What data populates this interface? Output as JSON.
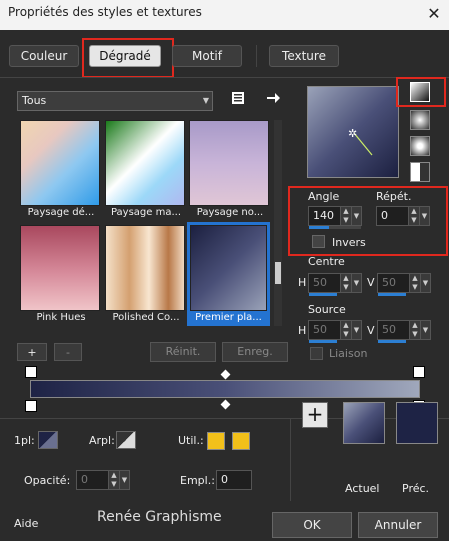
{
  "window": {
    "title": "Propriétés des styles et textures",
    "close": "✕"
  },
  "tabs": {
    "couleur": "Couleur",
    "degrade": "Dégradé",
    "motif": "Motif",
    "texture": "Texture"
  },
  "category": {
    "selected": "Tous"
  },
  "gradients": [
    {
      "label": "Paysage dé..."
    },
    {
      "label": "Paysage ma..."
    },
    {
      "label": "Paysage no..."
    },
    {
      "label": "Pink Hues"
    },
    {
      "label": "Polished Co..."
    },
    {
      "label": "Premier pla..."
    }
  ],
  "list_buttons": {
    "add": "+",
    "remove": "-",
    "reset": "Réinit.",
    "save": "Enreg."
  },
  "angle": {
    "label": "Angle",
    "value": "140",
    "level": 0.39
  },
  "repeat": {
    "label": "Répét.",
    "value": "0"
  },
  "invert": {
    "label": "Invers"
  },
  "centre": {
    "label": "Centre",
    "h_label": "H",
    "h_value": "50",
    "v_label": "V",
    "v_value": "50"
  },
  "source": {
    "label": "Source",
    "h_label": "H",
    "h_value": "50",
    "v_label": "V",
    "v_value": "50"
  },
  "link": {
    "label": "Liaison"
  },
  "bottom": {
    "one_px": "1pl:",
    "arpl": "Arpl:",
    "util": "Util.:",
    "opacity_label": "Opacité:",
    "opacity_value": "0",
    "empl_label": "Empl.:",
    "empl_value": "0",
    "add": "+",
    "current": "Actuel",
    "previous": "Préc."
  },
  "footer": {
    "help": "Aide",
    "watermark": "Renée Graphisme",
    "ok": "OK",
    "cancel": "Annuler"
  },
  "colors": {
    "accent": "#2c7fd3",
    "highlight": "#e0281e",
    "util": "#f2c01a",
    "prev": "#1e2345"
  }
}
